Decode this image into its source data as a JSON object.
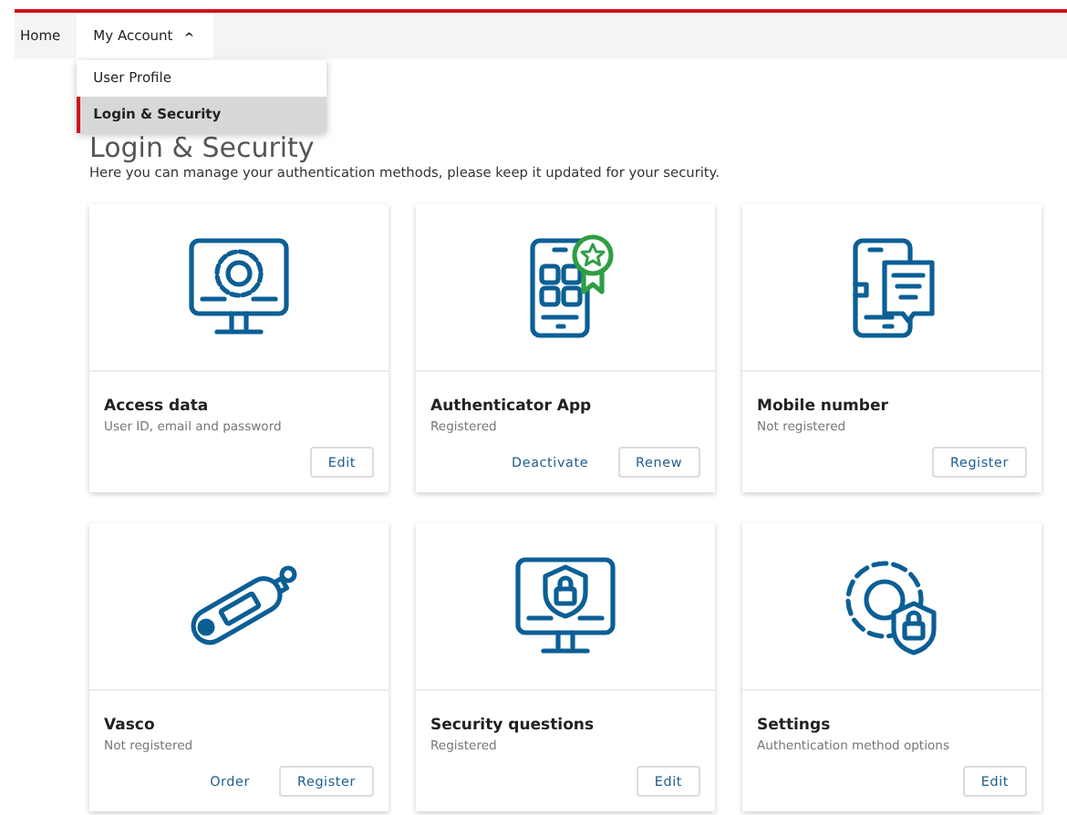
{
  "nav": {
    "items": [
      {
        "label": "Home",
        "selected": false,
        "kind": "link"
      },
      {
        "label": "My Account",
        "selected": true,
        "kind": "menu",
        "expanded": true,
        "caret": "^"
      }
    ]
  },
  "dropdown": {
    "items": [
      {
        "label": "User Profile",
        "selected": false
      },
      {
        "label": "Login & Security",
        "selected": true
      }
    ]
  },
  "page": {
    "title": "Login & Security",
    "description": "Here you can manage your authentication methods, please keep it updated for your security."
  },
  "cards": [
    {
      "title": "Access data",
      "subtitle": "User ID, email and password",
      "buttons": [
        {
          "label": "Edit",
          "kind": "outline"
        }
      ]
    },
    {
      "title": "Authenticator App",
      "subtitle": "Registered",
      "buttons": [
        {
          "label": "Deactivate",
          "kind": "link"
        },
        {
          "label": "Renew",
          "kind": "outline"
        }
      ]
    },
    {
      "title": "Mobile number",
      "subtitle": "Not registered",
      "buttons": [
        {
          "label": "Register",
          "kind": "outline"
        }
      ]
    },
    {
      "title": "Vasco",
      "subtitle": "Not registered",
      "buttons": [
        {
          "label": "Order",
          "kind": "link"
        },
        {
          "label": "Register",
          "kind": "outline"
        }
      ]
    },
    {
      "title": "Security questions",
      "subtitle": "Registered",
      "buttons": [
        {
          "label": "Edit",
          "kind": "outline"
        }
      ]
    },
    {
      "title": "Settings",
      "subtitle": "Authentication method options",
      "buttons": [
        {
          "label": "Edit",
          "kind": "outline"
        }
      ]
    }
  ]
}
